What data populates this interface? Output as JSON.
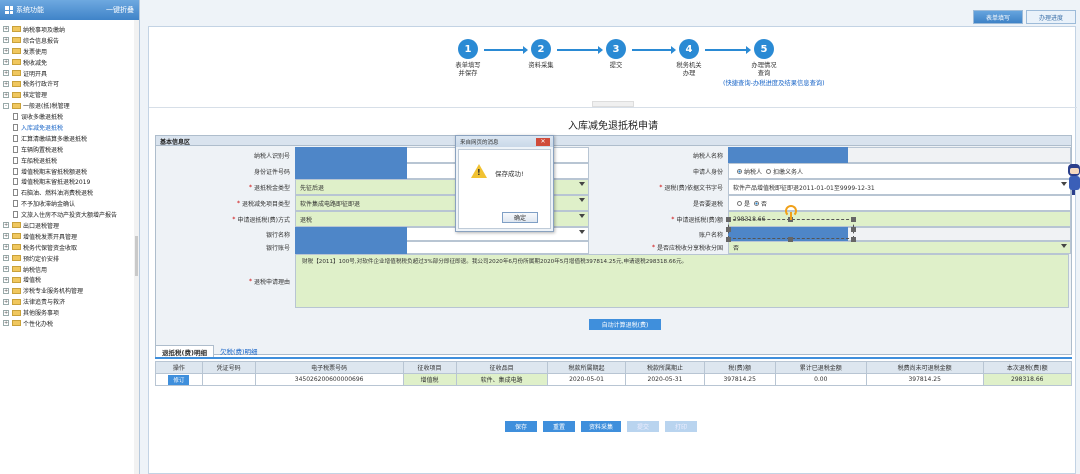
{
  "sidebar": {
    "title": "系统功能",
    "collapse_label": "一键折叠",
    "items": [
      {
        "label": "纳税事项及缴纳",
        "type": "folder"
      },
      {
        "label": "综合信息报告",
        "type": "folder"
      },
      {
        "label": "发票使用",
        "type": "folder"
      },
      {
        "label": "税收减免",
        "type": "folder"
      },
      {
        "label": "证明开具",
        "type": "folder"
      },
      {
        "label": "税务行政许可",
        "type": "folder"
      },
      {
        "label": "核定管理",
        "type": "folder"
      },
      {
        "label": "一般退(抵)税管理",
        "type": "folder-open"
      },
      {
        "label": "误收多缴退抵税",
        "type": "doc"
      },
      {
        "label": "入库减免退抵税",
        "type": "doc",
        "active": true
      },
      {
        "label": "汇算清缴结算多缴退抵税",
        "type": "doc"
      },
      {
        "label": "车辆购置税退税",
        "type": "doc"
      },
      {
        "label": "车船税退抵税",
        "type": "doc"
      },
      {
        "label": "增值税期末留抵税额退税",
        "type": "doc"
      },
      {
        "label": "增值税期末留抵退税2019",
        "type": "doc"
      },
      {
        "label": "石脑油、燃料油消费税退税",
        "type": "doc"
      },
      {
        "label": "不予加收滞纳金确认",
        "type": "doc"
      },
      {
        "label": "文旅入住房不动产投资大额增产报告",
        "type": "doc"
      },
      {
        "label": "出口退税管理",
        "type": "folder"
      },
      {
        "label": "增值税发票开具管理",
        "type": "folder"
      },
      {
        "label": "税务代保管资金收取",
        "type": "folder"
      },
      {
        "label": "预约定价安排",
        "type": "folder"
      },
      {
        "label": "纳税信用",
        "type": "folder"
      },
      {
        "label": "增值税",
        "type": "folder"
      },
      {
        "label": "涉税专业服务机构管理",
        "type": "folder"
      },
      {
        "label": "法律追责与救济",
        "type": "folder"
      },
      {
        "label": "其他服务事项",
        "type": "folder"
      },
      {
        "label": "个性化办税",
        "type": "folder"
      }
    ]
  },
  "header_tabs": [
    {
      "label": "表单填写",
      "active": true
    },
    {
      "label": "办理进度",
      "active": false
    }
  ],
  "steps": [
    {
      "num": "1",
      "label": "表单填写\n并保存"
    },
    {
      "num": "2",
      "label": "资料采集"
    },
    {
      "num": "3",
      "label": "提交"
    },
    {
      "num": "4",
      "label": "税务机关\n办理"
    },
    {
      "num": "5",
      "label": "办理情况\n查询"
    }
  ],
  "step_link": "(快捷查询-办税进度及结果信息查询)",
  "form_title": "入库减免退抵税申请",
  "form": {
    "section": "基本信息区",
    "taxpayer_id_label": "纳税人识别号",
    "taxpayer_name_label": "纳税人名称",
    "id_type_label": "身份证件号码",
    "applicant_role_label": "申请人身份",
    "role_option_1": "纳税人",
    "role_option_2": "扣缴义务人",
    "refund_type_label": "退抵税金类型",
    "refund_type_value": "先征后退",
    "refund_doc_label": "退税(费)依据文书字号",
    "refund_doc_value": "软件产品增值税即征即退2011-01-01至9999-12-31",
    "reduce_type_label": "退税减免项目类型",
    "reduce_type_value": "软件集成电路即征即退",
    "deduct_label": "是否要退税",
    "yes": "是",
    "no": "否",
    "method_label": "申请退抵税(费)方式",
    "method_value": "退税",
    "amount_label": "申请退抵税(费)额",
    "amount_value": "298318.66",
    "bank_label": "银行名称",
    "account_name_label": "账户名称",
    "account_no_label": "银行账号",
    "deduct_zone_label": "是否应税收分享税收分国",
    "deduct_zone_value": "否",
    "reason_label": "退税申请理由",
    "reason_text": "财税【2011】100号,对软件企业增值税税负超过3%部分即征即退。我公司2020年6月份所属期2020年5月增值税397814.25元,申请退税298318.66元。",
    "calc_button": "自动计算退税(费)"
  },
  "dialog": {
    "title": "来自网页的消息",
    "close": "✕",
    "message": "保存成功!",
    "ok": "确定"
  },
  "detail_tabs": [
    {
      "label": "退抵税(费)明细",
      "active": true
    },
    {
      "label": "欠税(费)明细",
      "active": false
    }
  ],
  "table": {
    "headers": [
      "操作",
      "凭证号码",
      "电子税票号码",
      "征收项目",
      "征收品目",
      "税款所属期起",
      "税款所属期止",
      "税(费)额",
      "累计已退税金额",
      "税费尚未可退税金额",
      "本次退税(费)额"
    ],
    "rows": [
      {
        "action": "修订",
        "voucher": "",
        "ticket": "345026200600000696",
        "item": "增值税",
        "sub_item": "软件、集成电路",
        "start": "2020-05-01",
        "end": "2020-05-31",
        "tax": "397814.25",
        "refunded": "0.00",
        "remaining": "397814.25",
        "current": "298318.66"
      }
    ]
  },
  "bottom_buttons": [
    {
      "label": "保存",
      "enabled": true
    },
    {
      "label": "重置",
      "enabled": true
    },
    {
      "label": "资料采集",
      "enabled": true
    },
    {
      "label": "提交",
      "enabled": false
    },
    {
      "label": "打印",
      "enabled": false
    }
  ],
  "colors": {
    "accent": "#2a8ad4",
    "field_green": "#dff0c9",
    "redact": "#4e86c8"
  }
}
